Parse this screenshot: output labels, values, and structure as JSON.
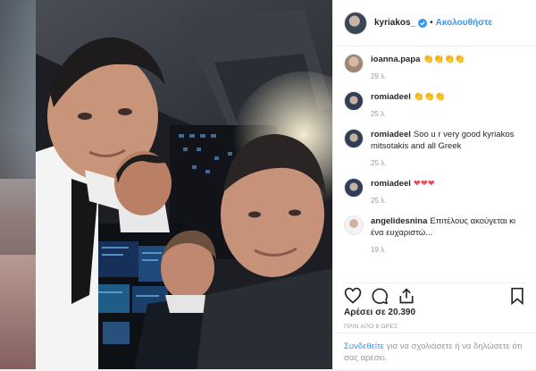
{
  "post": {
    "username": "kyriakos_",
    "separator": "•",
    "follow_label": "Ακολουθήστε",
    "likes": "Αρέσει σε 20.390",
    "time": "ΠΡΙΝ ΑΠΟ 8 ΩΡΕΣ"
  },
  "comments": [
    {
      "user": "ioanna.papa",
      "text": "👏👏👏👏",
      "time": "29 λ."
    },
    {
      "user": "romiadeel",
      "text": "👏👏👏",
      "time": "25 λ."
    },
    {
      "user": "romiadeel",
      "text": "Soo u r very good kyriakos mitsotakis and all Greek",
      "time": "25 λ."
    },
    {
      "user": "romiadeel",
      "text": "❤❤❤",
      "time": "25 λ."
    },
    {
      "user": "angelidesnina",
      "text": "Επιτέλους ακούγεται κι ένα ευχαριστώ...",
      "time": "19 λ."
    }
  ],
  "login": {
    "link": "Συνδεθείτε",
    "text": " για να σχολιάσετε ή να δηλώσετε ότι σας αρέσει."
  },
  "colors": {
    "accent": "#3897f0",
    "heart": "#ed4956",
    "text": "#262626"
  },
  "icons": [
    "verified-icon",
    "heart-icon",
    "comment-icon",
    "share-icon",
    "bookmark-icon"
  ]
}
